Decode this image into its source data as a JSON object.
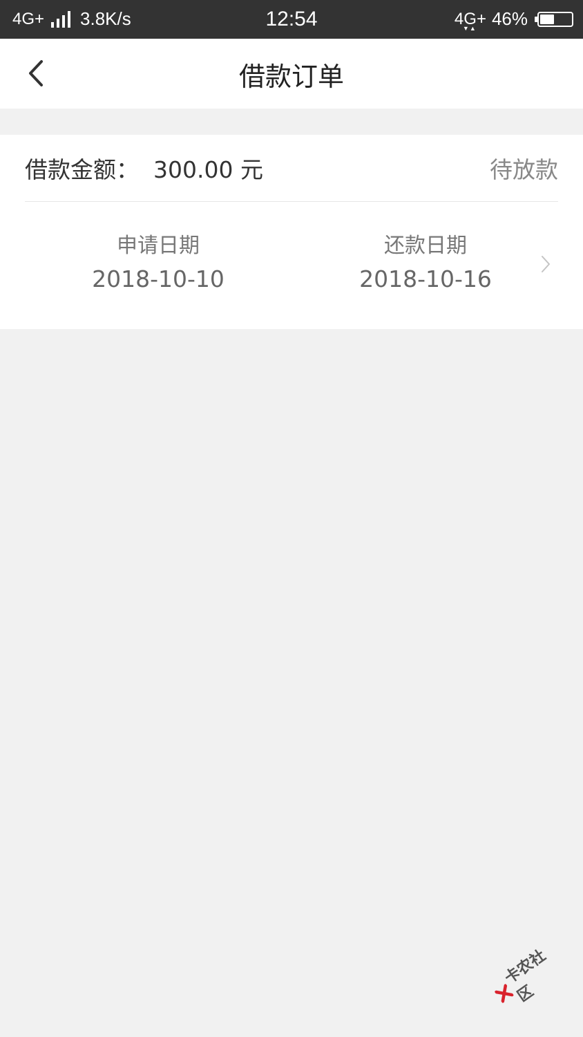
{
  "status_bar": {
    "network": "4G+",
    "speed": "3.8K/s",
    "time": "12:54",
    "network2": "4G+",
    "battery": "46%",
    "battery_level": 0.46
  },
  "nav": {
    "title": "借款订单",
    "back_icon": "chevron-left-icon"
  },
  "order": {
    "amount_label": "借款金额：",
    "amount_value": "300.00 元",
    "status": "待放款",
    "apply_label": "申请日期",
    "apply_date": "2018-10-10",
    "repay_label": "还款日期",
    "repay_date": "2018-10-16",
    "detail_icon": "chevron-right-icon"
  },
  "watermark": {
    "text": "卡农社区",
    "logo_color": "#d9232d"
  },
  "colors": {
    "status_bar_bg": "#333333",
    "page_bg": "#f1f1f1",
    "card_bg": "#ffffff"
  }
}
